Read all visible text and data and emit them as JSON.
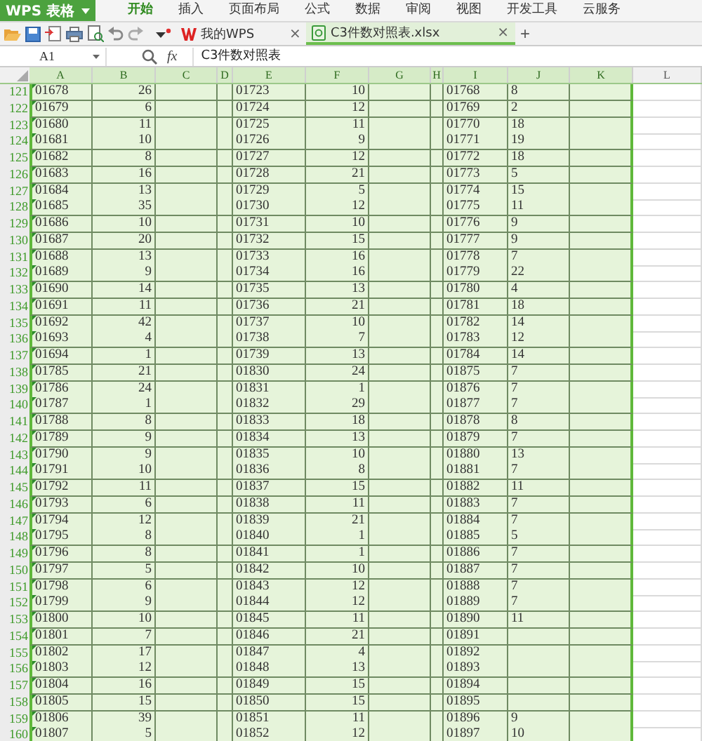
{
  "app": {
    "logo": "WPS 表格"
  },
  "menu": [
    {
      "label": "开始",
      "selected": true
    },
    {
      "label": "插入",
      "selected": false
    },
    {
      "label": "页面布局",
      "selected": false
    },
    {
      "label": "公式",
      "selected": false
    },
    {
      "label": "数据",
      "selected": false
    },
    {
      "label": "审阅",
      "selected": false
    },
    {
      "label": "视图",
      "selected": false
    },
    {
      "label": "开发工具",
      "selected": false
    },
    {
      "label": "云服务",
      "selected": false
    }
  ],
  "doc_tabs": [
    {
      "label": "我的WPS",
      "kind": "home",
      "selected": false,
      "close": "×"
    },
    {
      "label": "C3件数对照表.xlsx",
      "kind": "sheet",
      "selected": true,
      "close": "×"
    }
  ],
  "new_tab": "+",
  "name_box": "A1",
  "formula_bar": {
    "fx": "fx",
    "value": "C3件数对照表"
  },
  "sheet": {
    "columns": [
      {
        "label": "A",
        "in_range": true
      },
      {
        "label": "B",
        "in_range": true
      },
      {
        "label": "C",
        "in_range": true
      },
      {
        "label": "D",
        "in_range": true
      },
      {
        "label": "E",
        "in_range": true
      },
      {
        "label": "F",
        "in_range": true
      },
      {
        "label": "G",
        "in_range": true
      },
      {
        "label": "H",
        "in_range": true
      },
      {
        "label": "I",
        "in_range": true
      },
      {
        "label": "J",
        "in_range": true
      },
      {
        "label": "K",
        "in_range": true
      },
      {
        "label": "L",
        "in_range": false
      }
    ],
    "rows": [
      {
        "number": "121",
        "a": "01678",
        "b": "26",
        "e": "01723",
        "f": "10",
        "i": "01768",
        "j": "8"
      },
      {
        "number": "122",
        "a": "01679",
        "b": "6",
        "e": "01724",
        "f": "12",
        "i": "01769",
        "j": "2"
      },
      {
        "number": "123",
        "a": "01680",
        "b": "11",
        "e": "01725",
        "f": "11",
        "i": "01770",
        "j": "18"
      },
      {
        "number": "124",
        "a": "01681",
        "b": "10",
        "e": "01726",
        "f": "9",
        "i": "01771",
        "j": "19"
      },
      {
        "number": "125",
        "a": "01682",
        "b": "8",
        "e": "01727",
        "f": "12",
        "i": "01772",
        "j": "18"
      },
      {
        "number": "126",
        "a": "01683",
        "b": "16",
        "e": "01728",
        "f": "21",
        "i": "01773",
        "j": "5"
      },
      {
        "number": "127",
        "a": "01684",
        "b": "13",
        "e": "01729",
        "f": "5",
        "i": "01774",
        "j": "15"
      },
      {
        "number": "128",
        "a": "01685",
        "b": "35",
        "e": "01730",
        "f": "12",
        "i": "01775",
        "j": "11"
      },
      {
        "number": "129",
        "a": "01686",
        "b": "10",
        "e": "01731",
        "f": "10",
        "i": "01776",
        "j": "9"
      },
      {
        "number": "130",
        "a": "01687",
        "b": "20",
        "e": "01732",
        "f": "15",
        "i": "01777",
        "j": "9"
      },
      {
        "number": "131",
        "a": "01688",
        "b": "13",
        "e": "01733",
        "f": "16",
        "i": "01778",
        "j": "7"
      },
      {
        "number": "132",
        "a": "01689",
        "b": "9",
        "e": "01734",
        "f": "16",
        "i": "01779",
        "j": "22"
      },
      {
        "number": "133",
        "a": "01690",
        "b": "14",
        "e": "01735",
        "f": "13",
        "i": "01780",
        "j": "4"
      },
      {
        "number": "134",
        "a": "01691",
        "b": "11",
        "e": "01736",
        "f": "21",
        "i": "01781",
        "j": "18"
      },
      {
        "number": "135",
        "a": "01692",
        "b": "42",
        "e": "01737",
        "f": "10",
        "i": "01782",
        "j": "14"
      },
      {
        "number": "136",
        "a": "01693",
        "b": "4",
        "e": "01738",
        "f": "7",
        "i": "01783",
        "j": "12"
      },
      {
        "number": "137",
        "a": "01694",
        "b": "1",
        "e": "01739",
        "f": "13",
        "i": "01784",
        "j": "14"
      },
      {
        "number": "138",
        "a": "01785",
        "b": "21",
        "e": "01830",
        "f": "24",
        "i": "01875",
        "j": "7"
      },
      {
        "number": "139",
        "a": "01786",
        "b": "24",
        "e": "01831",
        "f": "1",
        "i": "01876",
        "j": "7"
      },
      {
        "number": "140",
        "a": "01787",
        "b": "1",
        "e": "01832",
        "f": "29",
        "i": "01877",
        "j": "7"
      },
      {
        "number": "141",
        "a": "01788",
        "b": "8",
        "e": "01833",
        "f": "18",
        "i": "01878",
        "j": "8"
      },
      {
        "number": "142",
        "a": "01789",
        "b": "9",
        "e": "01834",
        "f": "13",
        "i": "01879",
        "j": "7"
      },
      {
        "number": "143",
        "a": "01790",
        "b": "9",
        "e": "01835",
        "f": "10",
        "i": "01880",
        "j": "13"
      },
      {
        "number": "144",
        "a": "01791",
        "b": "10",
        "e": "01836",
        "f": "8",
        "i": "01881",
        "j": "7"
      },
      {
        "number": "145",
        "a": "01792",
        "b": "11",
        "e": "01837",
        "f": "15",
        "i": "01882",
        "j": "11"
      },
      {
        "number": "146",
        "a": "01793",
        "b": "6",
        "e": "01838",
        "f": "11",
        "i": "01883",
        "j": "7"
      },
      {
        "number": "147",
        "a": "01794",
        "b": "12",
        "e": "01839",
        "f": "21",
        "i": "01884",
        "j": "7"
      },
      {
        "number": "148",
        "a": "01795",
        "b": "8",
        "e": "01840",
        "f": "1",
        "i": "01885",
        "j": "5"
      },
      {
        "number": "149",
        "a": "01796",
        "b": "8",
        "e": "01841",
        "f": "1",
        "i": "01886",
        "j": "7"
      },
      {
        "number": "150",
        "a": "01797",
        "b": "5",
        "e": "01842",
        "f": "10",
        "i": "01887",
        "j": "7"
      },
      {
        "number": "151",
        "a": "01798",
        "b": "6",
        "e": "01843",
        "f": "12",
        "i": "01888",
        "j": "7"
      },
      {
        "number": "152",
        "a": "01799",
        "b": "9",
        "e": "01844",
        "f": "12",
        "i": "01889",
        "j": "7"
      },
      {
        "number": "153",
        "a": "01800",
        "b": "10",
        "e": "01845",
        "f": "11",
        "i": "01890",
        "j": "11"
      },
      {
        "number": "154",
        "a": "01801",
        "b": "7",
        "e": "01846",
        "f": "21",
        "i": "01891"
      },
      {
        "number": "155",
        "a": "01802",
        "b": "17",
        "e": "01847",
        "f": "4",
        "i": "01892"
      },
      {
        "number": "156",
        "a": "01803",
        "b": "12",
        "e": "01848",
        "f": "13",
        "i": "01893"
      },
      {
        "number": "157",
        "a": "01804",
        "b": "16",
        "e": "01849",
        "f": "15",
        "i": "01894"
      },
      {
        "number": "158",
        "a": "01805",
        "b": "15",
        "e": "01850",
        "f": "15",
        "i": "01895"
      },
      {
        "number": "159",
        "a": "01806",
        "b": "39",
        "e": "01851",
        "f": "11",
        "i": "01896",
        "j": "9"
      },
      {
        "number": "160",
        "a": "01807",
        "b": "5",
        "e": "01852",
        "f": "12",
        "i": "01897",
        "j": "10"
      }
    ]
  }
}
